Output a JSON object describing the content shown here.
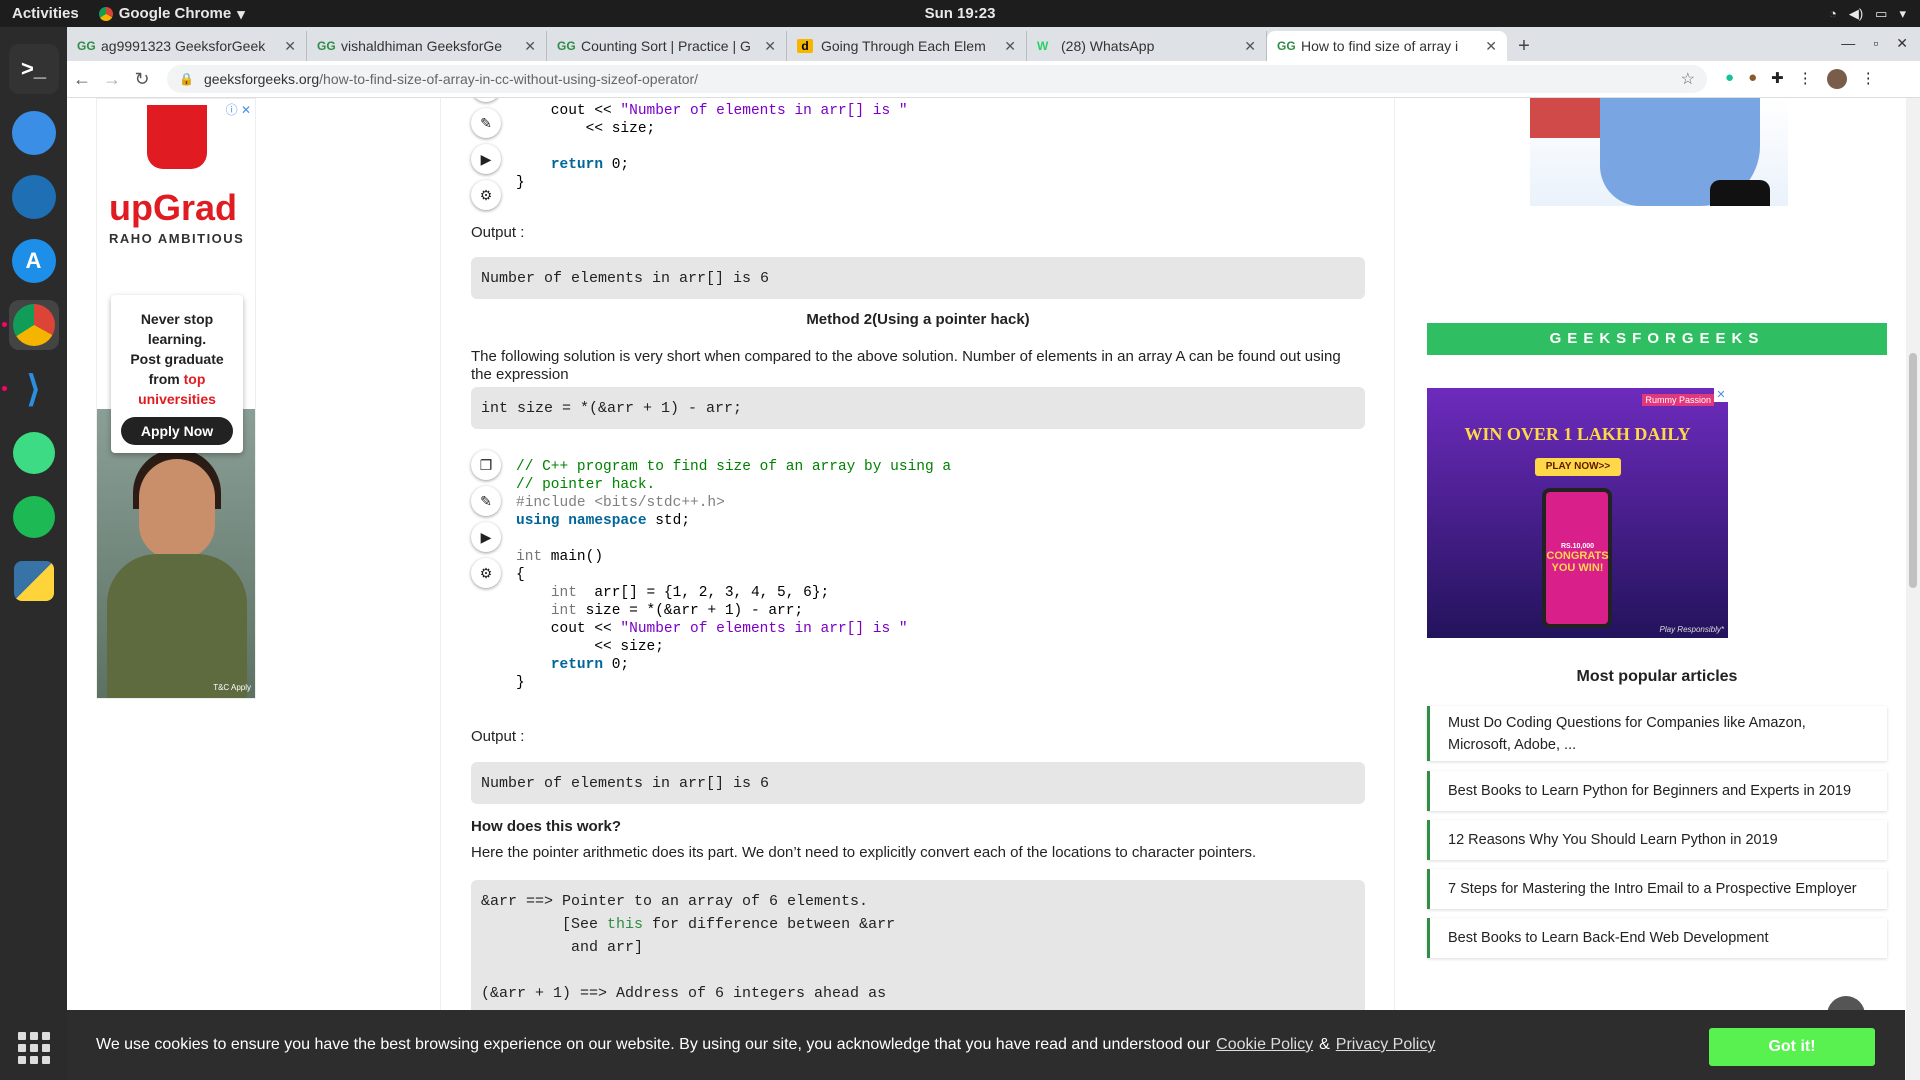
{
  "topbar": {
    "activities": "Activities",
    "app": "Google Chrome",
    "clock": "Sun 19:23"
  },
  "tabs": [
    {
      "title": "ag9991323 GeeksforGeek",
      "fav": "GG"
    },
    {
      "title": "vishaldhiman GeeksforGe",
      "fav": "GG"
    },
    {
      "title": "Counting Sort | Practice | G",
      "fav": "GG"
    },
    {
      "title": "Going Through Each Elem",
      "fav": "d"
    },
    {
      "title": "(28) WhatsApp",
      "fav": "W"
    },
    {
      "title": "How to find size of array i",
      "fav": "GG"
    }
  ],
  "address": {
    "host": "geeksforgeeks.org",
    "path": "/how-to-find-size-of-array-in-cc-without-using-sizeof-operator/"
  },
  "ad_left": {
    "brand": "upGrad",
    "tagline": "RAHO AMBITIOUS",
    "line1": "Never stop",
    "line2": "learning.",
    "line3": "Post graduate",
    "line4": "from ",
    "line4_red": "top",
    "line5": "universities",
    "button": "Apply Now",
    "tc": "T&C Apply"
  },
  "content": {
    "code1": {
      "l1a": "    cout << ",
      "l1b": "\"Number of elements in arr[] is \"",
      "l2": "        << size;",
      "l3": "    ",
      "l3kw": "return",
      "l3b": " 0;",
      "l4": "}"
    },
    "output1_label": "Output :",
    "output1": "Number of elements in arr[] is 6",
    "method2": "Method 2(Using a pointer hack)",
    "para1": "The following solution is very short when compared to the above solution. Number of elements in an array A can be found out using the expression",
    "expr": "int size = *(&arr + 1) - arr;",
    "code2": {
      "c1": "// C++ program to find size of an array by using a",
      "c2": "// pointer hack.",
      "c3": "#include <bits/stdc++.h>",
      "c4kw": "using namespace",
      "c4": " std;",
      "c5ty": "int",
      "c5": " main()",
      "c6": "{",
      "c7ty": "int",
      "c7": "  arr[] = {1, 2, 3, 4, 5, 6};",
      "c8ty": "int",
      "c8": " size = *(&arr + 1) - arr;",
      "c9a": "    cout << ",
      "c9b": "\"Number of elements in arr[] is \"",
      "c10": "         << size;",
      "c11kw": "return",
      "c11": " 0;",
      "c12": "}"
    },
    "output2_label": "Output :",
    "output2": "Number of elements in arr[] is 6",
    "how_title": "How does this work?",
    "how_para": "Here the pointer arithmetic does its part. We don’t need to explicitly convert each of the locations to character pointers.",
    "explain": {
      "l1": "&arr ==> Pointer to an array of 6 elements.",
      "l2a": "         [See ",
      "l2link": "this",
      "l2b": " for difference between &arr",
      "l3": "          and arr]",
      "l4": "(&arr + 1) ==> Address of 6 integers ahead as"
    }
  },
  "side": {
    "gfg": "GEEKSFORGEEKS",
    "ad": {
      "headline": "WIN OVER 1 LAKH DAILY",
      "play": "PLAY NOW>>",
      "congrats": "CONGRATS",
      "you_win": "YOU WIN!",
      "brand": "Rummy Passion",
      "amount": "RS.10,000",
      "responsibly": "Play Responsibly*"
    },
    "popular_title": "Most popular articles",
    "popular": [
      "Must Do Coding Questions for Companies like Amazon, Microsoft, Adobe, ...",
      "Best Books to Learn Python for Beginners and Experts in 2019",
      "12 Reasons Why You Should Learn Python in 2019",
      "7 Steps for Mastering the Intro Email to a Prospective Employer",
      "Best Books to Learn Back-End Web Development"
    ]
  },
  "cookie": {
    "text": "We use cookies to ensure you have the best browsing experience on our website. By using our site, you acknowledge that you have read and understood our",
    "policy": "Cookie Policy",
    "amp": "&",
    "privacy": "Privacy Policy",
    "button": "Got it!"
  }
}
